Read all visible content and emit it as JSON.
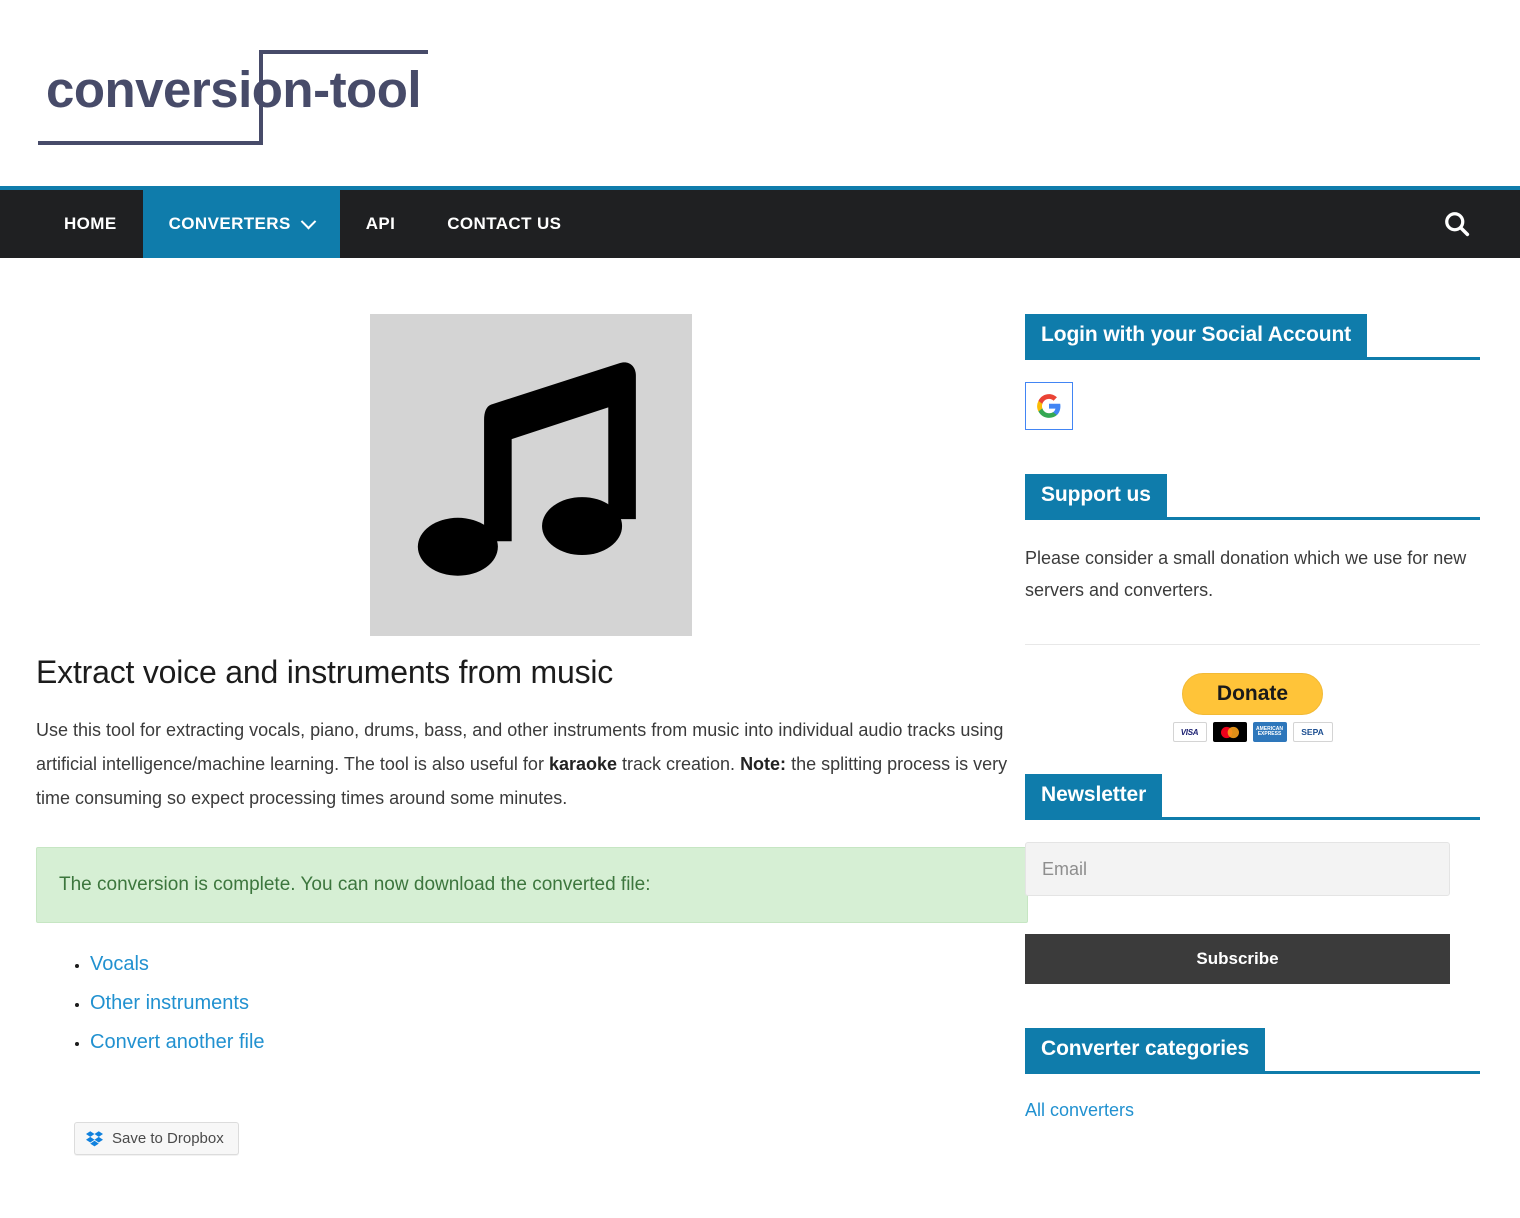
{
  "header": {
    "logo_text": "conversion-tool"
  },
  "nav": {
    "items": [
      {
        "label": "HOME",
        "active": false,
        "has_caret": false
      },
      {
        "label": "CONVERTERS",
        "active": true,
        "has_caret": true
      },
      {
        "label": "API",
        "active": false,
        "has_caret": false
      },
      {
        "label": "CONTACT US",
        "active": false,
        "has_caret": false
      }
    ],
    "search_icon": "search-icon",
    "accent_color": "#0f7cab",
    "bar_color": "#1f2022"
  },
  "main": {
    "hero_icon": "music-note-icon",
    "title": "Extract voice and instruments from music",
    "description_part1": "Use this tool for extracting vocals, piano, drums, bass, and other instruments from music into individual audio tracks using artificial intelligence/machine learning. The tool is also useful for ",
    "description_bold1": "karaoke",
    "description_part2": " track creation. ",
    "description_bold2": "Note:",
    "description_part3": " the splitting process is very time consuming so expect processing times around some minutes.",
    "alert_text": "The conversion is complete. You can now download the converted file:",
    "alert_color": "#d6efd4",
    "alert_text_color": "#3c763d",
    "download_links": [
      {
        "label": "Vocals"
      },
      {
        "label": "Other instruments"
      },
      {
        "label": "Convert another file"
      }
    ],
    "dropbox_button": "Save to Dropbox"
  },
  "sidebar": {
    "social": {
      "title": "Login with your Social Account",
      "providers": [
        {
          "name": "google-icon"
        }
      ]
    },
    "support": {
      "title": "Support us",
      "text": "Please consider a small donation which we use for new servers and converters.",
      "donate_label": "Donate",
      "cards": [
        {
          "name": "visa-logo",
          "label": "VISA"
        },
        {
          "name": "mastercard-logo",
          "label": ""
        },
        {
          "name": "amex-logo",
          "label": "AMERICAN EXPRESS"
        },
        {
          "name": "sepa-logo",
          "label": "SEPA"
        }
      ]
    },
    "newsletter": {
      "title": "Newsletter",
      "email_placeholder": "Email",
      "email_value": "",
      "subscribe_label": "Subscribe"
    },
    "categories": {
      "title": "Converter categories",
      "links": [
        {
          "label": "All converters"
        }
      ]
    }
  },
  "colors": {
    "accent_blue": "#0f7cab",
    "link_blue": "#2191d0",
    "logo_navy": "#474b69",
    "nav_dark": "#1f2022",
    "donate_yellow": "#ffc439"
  }
}
